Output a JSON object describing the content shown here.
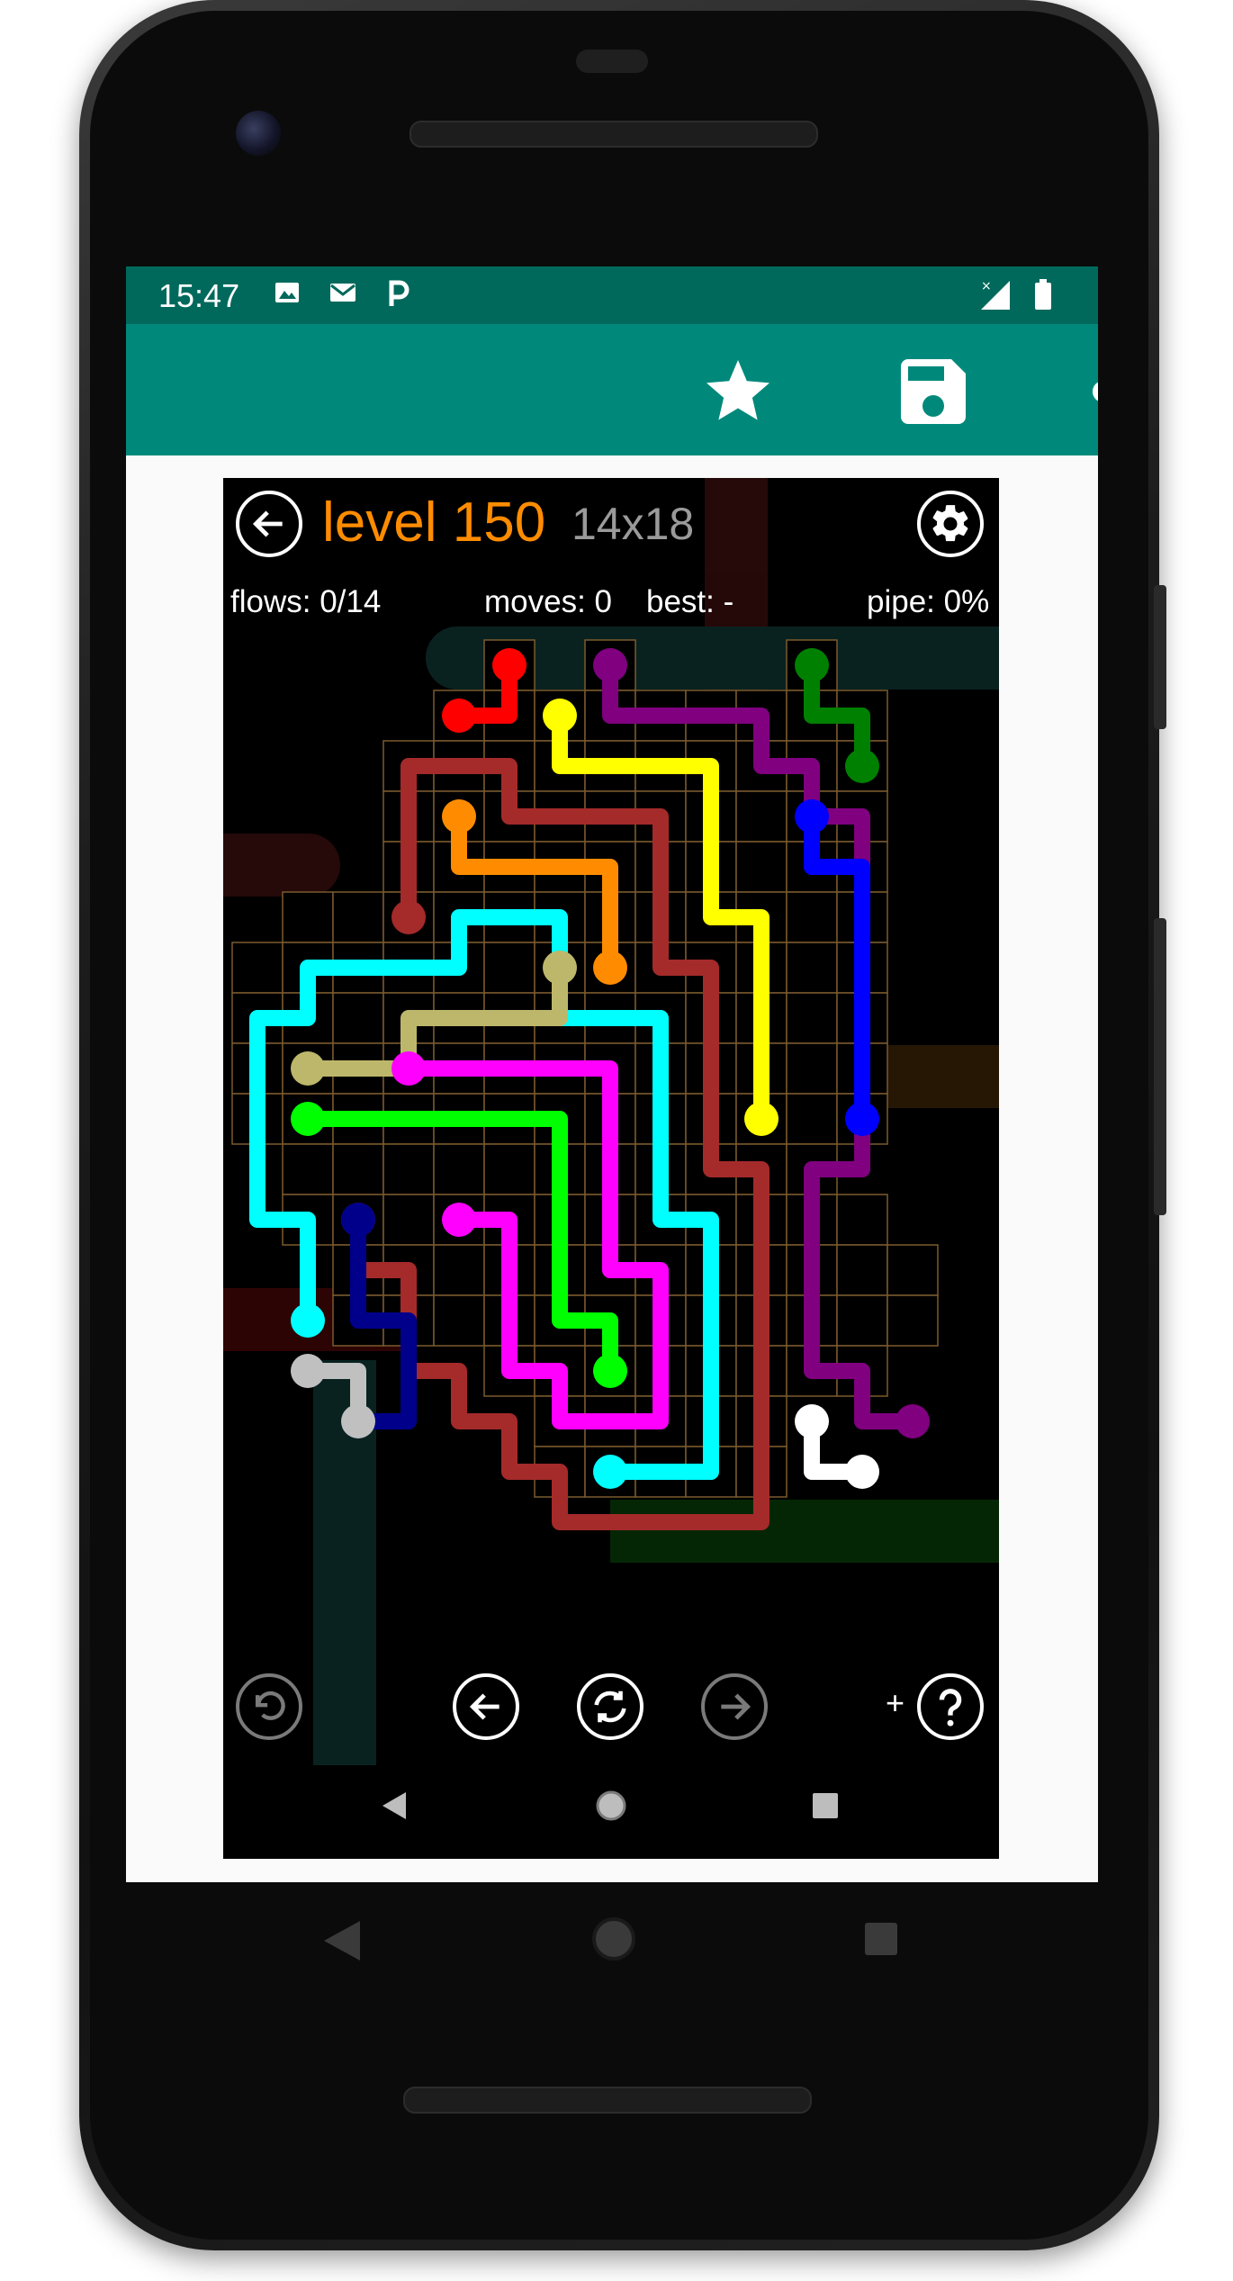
{
  "status_bar": {
    "time": "15:47",
    "notification_icons": [
      "image-icon",
      "gmail-icon",
      "p-icon"
    ],
    "system_icons": [
      "signal-icon",
      "battery-icon"
    ],
    "color": "#00695c"
  },
  "app_bar": {
    "color": "#00897b",
    "actions": [
      "star-icon",
      "save-icon",
      "share-icon"
    ]
  },
  "game": {
    "level_label": "level 150",
    "grid_size": "14x18",
    "flows": "flows: 0/14",
    "moves": "moves: 0",
    "best": "best: -",
    "pipe": "pipe: 0%",
    "accent_color": "#ff8c00",
    "plus_label": "+",
    "bottom_buttons": [
      "undo-icon",
      "previous-level-icon",
      "restart-icon",
      "next-level-icon",
      "hint-icon"
    ]
  },
  "flow_colors": [
    "#ff0000",
    "#800080",
    "#008000",
    "#ffff00",
    "#a52a2a",
    "#ff8c00",
    "#0000ff",
    "#00ffff",
    "#bdb76b",
    "#ff00ff",
    "#00ff00",
    "#00008b",
    "#c0c0c0",
    "#ffffff"
  ]
}
